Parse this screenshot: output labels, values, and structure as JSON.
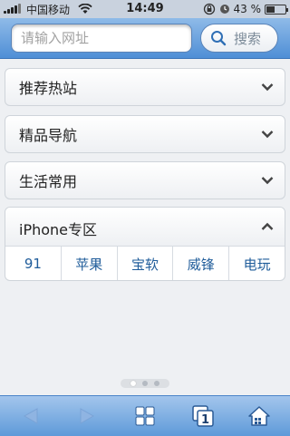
{
  "status_bar": {
    "carrier": "中国移动",
    "time": "14:49",
    "battery": "43 %",
    "battery_level": 0.43
  },
  "top_bar": {
    "url_placeholder": "请输入网址",
    "search_label": "搜索"
  },
  "sections": [
    {
      "label": "推荐热站",
      "expanded": false
    },
    {
      "label": "精品导航",
      "expanded": false
    },
    {
      "label": "生活常用",
      "expanded": false
    }
  ],
  "iphone_section": {
    "label": "iPhone专区",
    "expanded": true,
    "links": [
      "91",
      "苹果",
      "宝软",
      "威锋",
      "电玩"
    ]
  },
  "page_indicator": {
    "count": 3,
    "active": 0
  },
  "bottom_bar": {
    "tab_count": "1",
    "icons": [
      "back-icon",
      "forward-icon",
      "grid-icon",
      "tabs-icon",
      "home-icon"
    ]
  },
  "colors": {
    "toolbar_top": "#8fbbe8",
    "toolbar_bottom": "#4f8fd6",
    "link": "#1f5c9a"
  }
}
